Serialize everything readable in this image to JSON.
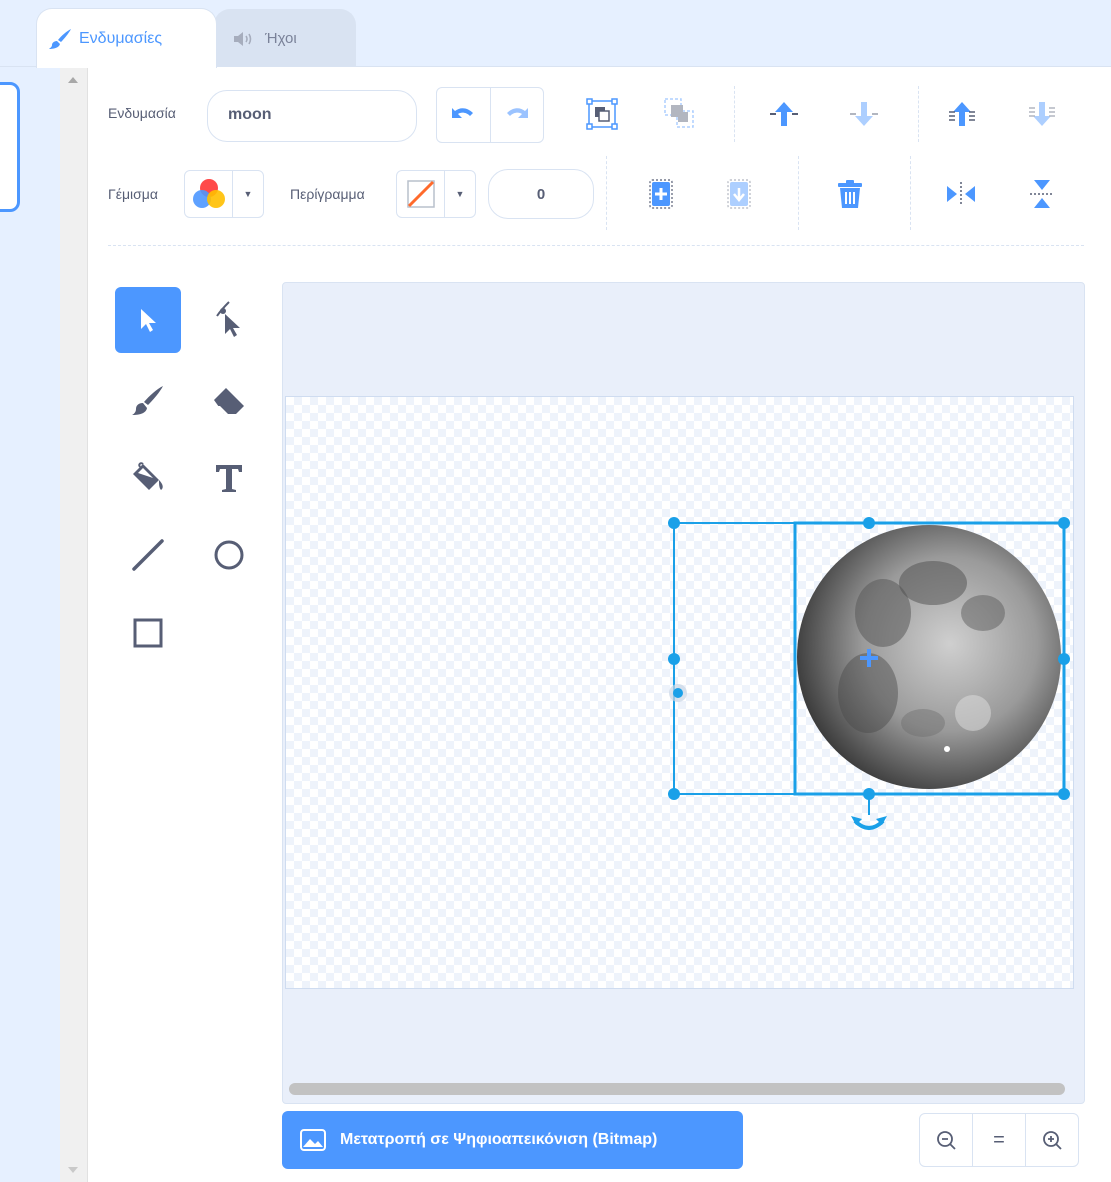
{
  "tabs": {
    "costumes_label": "Ενδυμασίες",
    "sounds_label": "Ήχοι"
  },
  "toolbar": {
    "costume_label": "Ενδυμασία",
    "costume_name": "moon",
    "fill_label": "Γέμισμα",
    "outline_label": "Περίγραμμα",
    "outline_width": "0"
  },
  "actions": {
    "convert_bitmap_label": "Μετατροπή σε Ψηφιοαπεικόνιση (Bitmap)",
    "zoom_reset_label": "="
  },
  "colors": {
    "accent": "#4c97ff",
    "selection": "#1aa0e8",
    "outline_slash": "#ff6a2b",
    "tab_bar": "#e6f0ff"
  },
  "icons": {
    "tools": [
      "select-icon",
      "reshape-icon",
      "brush-icon",
      "eraser-icon",
      "fill-icon",
      "text-icon",
      "line-icon",
      "circle-icon",
      "rectangle-icon"
    ]
  }
}
